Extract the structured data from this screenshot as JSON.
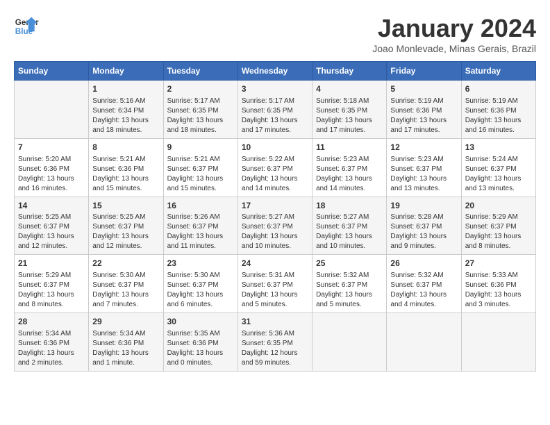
{
  "header": {
    "logo_line1": "General",
    "logo_line2": "Blue",
    "month_title": "January 2024",
    "subtitle": "Joao Monlevade, Minas Gerais, Brazil"
  },
  "weekdays": [
    "Sunday",
    "Monday",
    "Tuesday",
    "Wednesday",
    "Thursday",
    "Friday",
    "Saturday"
  ],
  "weeks": [
    [
      {
        "day": "",
        "content": ""
      },
      {
        "day": "1",
        "content": "Sunrise: 5:16 AM\nSunset: 6:34 PM\nDaylight: 13 hours\nand 18 minutes."
      },
      {
        "day": "2",
        "content": "Sunrise: 5:17 AM\nSunset: 6:35 PM\nDaylight: 13 hours\nand 18 minutes."
      },
      {
        "day": "3",
        "content": "Sunrise: 5:17 AM\nSunset: 6:35 PM\nDaylight: 13 hours\nand 17 minutes."
      },
      {
        "day": "4",
        "content": "Sunrise: 5:18 AM\nSunset: 6:35 PM\nDaylight: 13 hours\nand 17 minutes."
      },
      {
        "day": "5",
        "content": "Sunrise: 5:19 AM\nSunset: 6:36 PM\nDaylight: 13 hours\nand 17 minutes."
      },
      {
        "day": "6",
        "content": "Sunrise: 5:19 AM\nSunset: 6:36 PM\nDaylight: 13 hours\nand 16 minutes."
      }
    ],
    [
      {
        "day": "7",
        "content": "Sunrise: 5:20 AM\nSunset: 6:36 PM\nDaylight: 13 hours\nand 16 minutes."
      },
      {
        "day": "8",
        "content": "Sunrise: 5:21 AM\nSunset: 6:36 PM\nDaylight: 13 hours\nand 15 minutes."
      },
      {
        "day": "9",
        "content": "Sunrise: 5:21 AM\nSunset: 6:37 PM\nDaylight: 13 hours\nand 15 minutes."
      },
      {
        "day": "10",
        "content": "Sunrise: 5:22 AM\nSunset: 6:37 PM\nDaylight: 13 hours\nand 14 minutes."
      },
      {
        "day": "11",
        "content": "Sunrise: 5:23 AM\nSunset: 6:37 PM\nDaylight: 13 hours\nand 14 minutes."
      },
      {
        "day": "12",
        "content": "Sunrise: 5:23 AM\nSunset: 6:37 PM\nDaylight: 13 hours\nand 13 minutes."
      },
      {
        "day": "13",
        "content": "Sunrise: 5:24 AM\nSunset: 6:37 PM\nDaylight: 13 hours\nand 13 minutes."
      }
    ],
    [
      {
        "day": "14",
        "content": "Sunrise: 5:25 AM\nSunset: 6:37 PM\nDaylight: 13 hours\nand 12 minutes."
      },
      {
        "day": "15",
        "content": "Sunrise: 5:25 AM\nSunset: 6:37 PM\nDaylight: 13 hours\nand 12 minutes."
      },
      {
        "day": "16",
        "content": "Sunrise: 5:26 AM\nSunset: 6:37 PM\nDaylight: 13 hours\nand 11 minutes."
      },
      {
        "day": "17",
        "content": "Sunrise: 5:27 AM\nSunset: 6:37 PM\nDaylight: 13 hours\nand 10 minutes."
      },
      {
        "day": "18",
        "content": "Sunrise: 5:27 AM\nSunset: 6:37 PM\nDaylight: 13 hours\nand 10 minutes."
      },
      {
        "day": "19",
        "content": "Sunrise: 5:28 AM\nSunset: 6:37 PM\nDaylight: 13 hours\nand 9 minutes."
      },
      {
        "day": "20",
        "content": "Sunrise: 5:29 AM\nSunset: 6:37 PM\nDaylight: 13 hours\nand 8 minutes."
      }
    ],
    [
      {
        "day": "21",
        "content": "Sunrise: 5:29 AM\nSunset: 6:37 PM\nDaylight: 13 hours\nand 8 minutes."
      },
      {
        "day": "22",
        "content": "Sunrise: 5:30 AM\nSunset: 6:37 PM\nDaylight: 13 hours\nand 7 minutes."
      },
      {
        "day": "23",
        "content": "Sunrise: 5:30 AM\nSunset: 6:37 PM\nDaylight: 13 hours\nand 6 minutes."
      },
      {
        "day": "24",
        "content": "Sunrise: 5:31 AM\nSunset: 6:37 PM\nDaylight: 13 hours\nand 5 minutes."
      },
      {
        "day": "25",
        "content": "Sunrise: 5:32 AM\nSunset: 6:37 PM\nDaylight: 13 hours\nand 5 minutes."
      },
      {
        "day": "26",
        "content": "Sunrise: 5:32 AM\nSunset: 6:37 PM\nDaylight: 13 hours\nand 4 minutes."
      },
      {
        "day": "27",
        "content": "Sunrise: 5:33 AM\nSunset: 6:36 PM\nDaylight: 13 hours\nand 3 minutes."
      }
    ],
    [
      {
        "day": "28",
        "content": "Sunrise: 5:34 AM\nSunset: 6:36 PM\nDaylight: 13 hours\nand 2 minutes."
      },
      {
        "day": "29",
        "content": "Sunrise: 5:34 AM\nSunset: 6:36 PM\nDaylight: 13 hours\nand 1 minute."
      },
      {
        "day": "30",
        "content": "Sunrise: 5:35 AM\nSunset: 6:36 PM\nDaylight: 13 hours\nand 0 minutes."
      },
      {
        "day": "31",
        "content": "Sunrise: 5:36 AM\nSunset: 6:35 PM\nDaylight: 12 hours\nand 59 minutes."
      },
      {
        "day": "",
        "content": ""
      },
      {
        "day": "",
        "content": ""
      },
      {
        "day": "",
        "content": ""
      }
    ]
  ]
}
